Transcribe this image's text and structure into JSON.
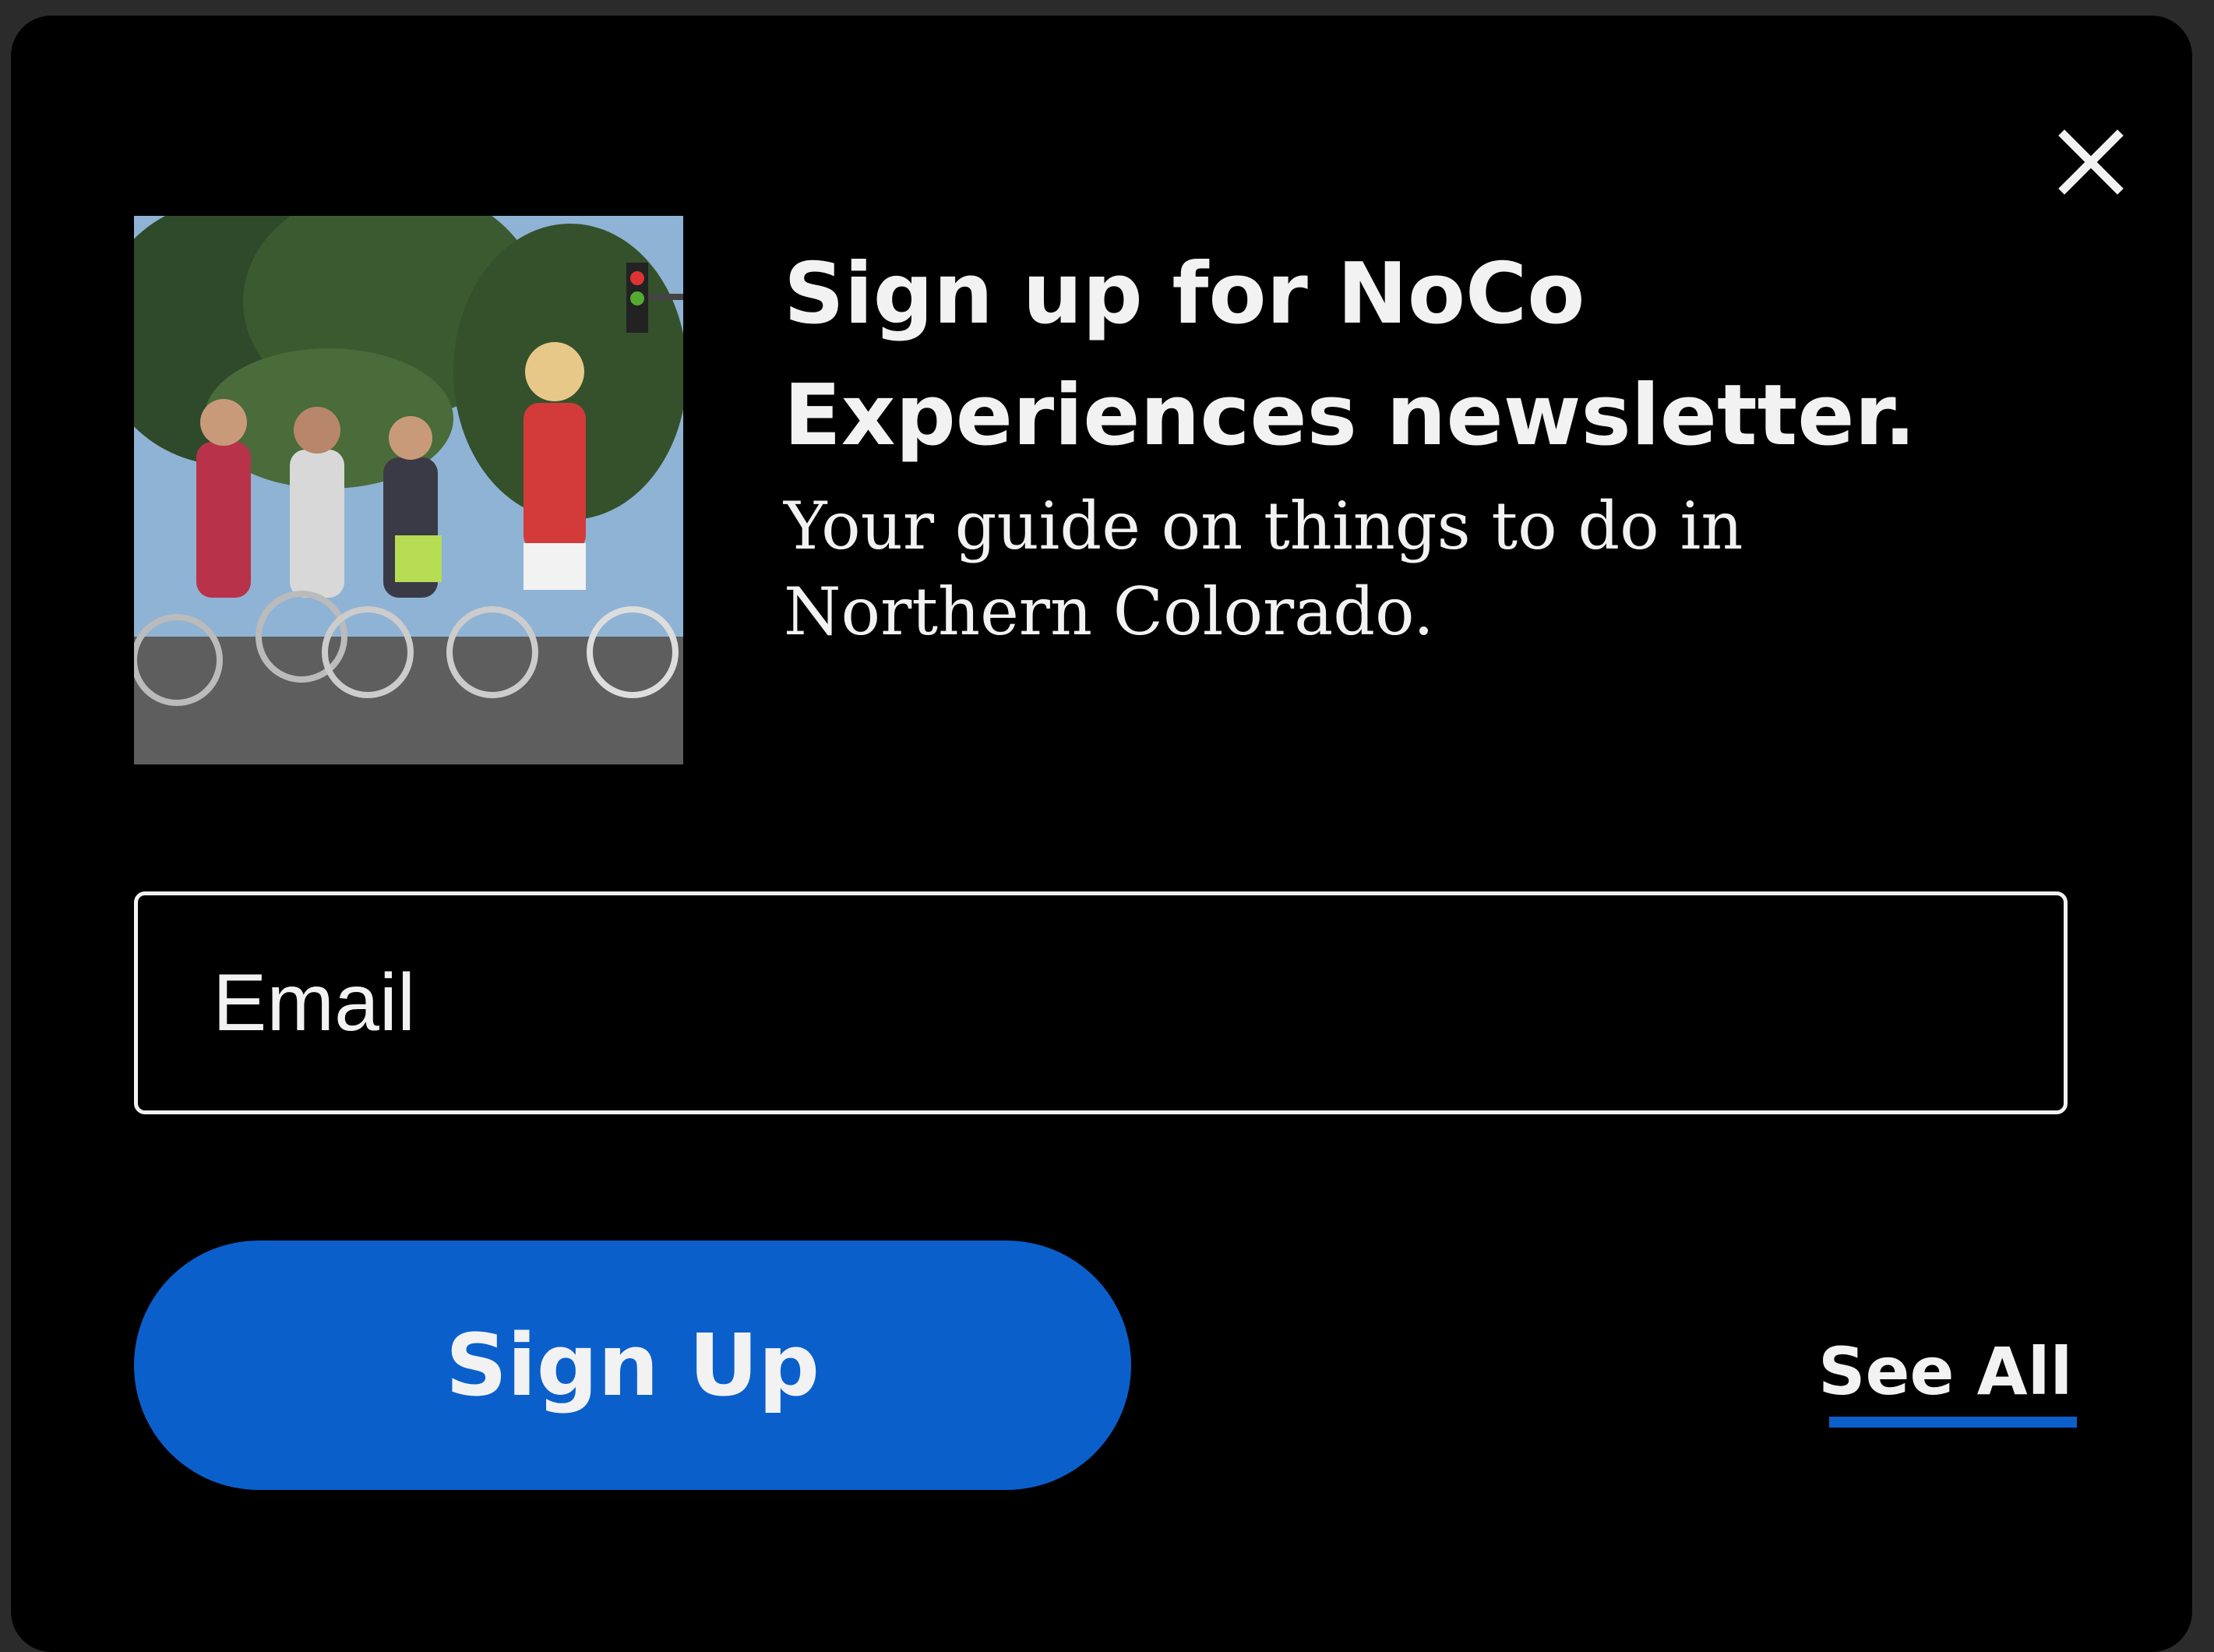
{
  "modal": {
    "close_icon": "close-icon",
    "image_icon": "newsletter-thumbnail",
    "title": "Sign up for NoCo Experiences newsletter.",
    "subtitle": "Your guide on things to do in Northern Colorado.",
    "email": {
      "placeholder": "Email",
      "value": ""
    },
    "signup_label": "Sign Up",
    "see_all_label": "See All"
  },
  "colors": {
    "background": "#000000",
    "text": "#f2f2f2",
    "accent": "#0b5fcb"
  }
}
